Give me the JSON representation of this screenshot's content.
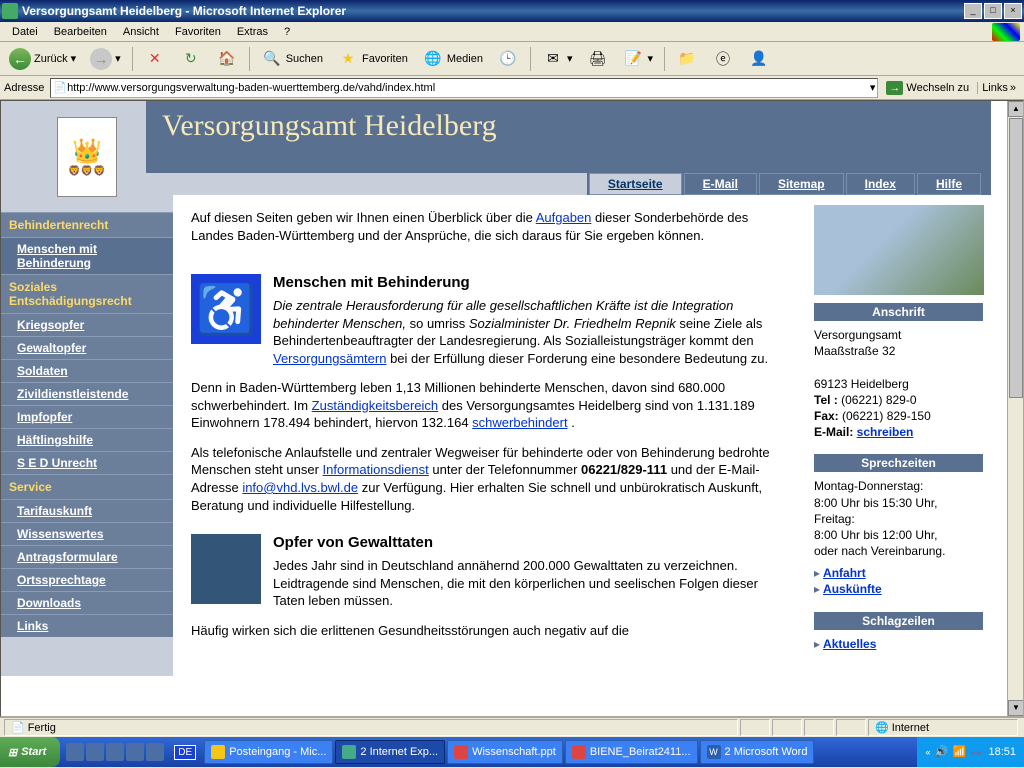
{
  "window": {
    "title": "Versorgungsamt Heidelberg - Microsoft Internet Explorer"
  },
  "menu": {
    "items": [
      "Datei",
      "Bearbeiten",
      "Ansicht",
      "Favoriten",
      "Extras",
      "?"
    ]
  },
  "toolbar": {
    "back": "Zurück",
    "search": "Suchen",
    "favorites": "Favoriten",
    "media": "Medien"
  },
  "address": {
    "label": "Adresse",
    "url": "http://www.versorgungsverwaltung-baden-wuerttemberg.de/vahd/index.html",
    "go": "Wechseln zu",
    "links": "Links"
  },
  "page": {
    "site_title": "Versorgungsamt Heidelberg",
    "topnav": [
      "Startseite",
      "E-Mail",
      "Sitemap",
      "Index",
      "Hilfe"
    ],
    "sidenav": {
      "cat1": "Behindertenrecht",
      "cat1_items": [
        "Menschen mit Behinderung"
      ],
      "cat2": "Soziales Entschädigungsrecht",
      "cat2_items": [
        "Kriegsopfer",
        "Gewaltopfer",
        "Soldaten",
        "Zivildienstleistende",
        "Impfopfer",
        "Häftlingshilfe",
        "S E D Unrecht"
      ],
      "cat3": "Service",
      "cat3_items": [
        "Tarifauskunft",
        "Wissenswertes",
        "Antragsformulare",
        "Ortssprechtage",
        "Downloads",
        "Links"
      ]
    },
    "intro": {
      "part1": "Auf diesen Seiten geben wir Ihnen einen   Überblick   über die ",
      "link1": "Aufgaben",
      "part2": "  dieser Sonderbehörde des Landes Baden-Württemberg und der Ansprüche, die sich daraus für Sie ergeben können."
    },
    "section1": {
      "head": "Menschen mit Behinderung",
      "p1a": "Die zentrale Herausforderung für alle gesellschaftlichen Kräfte ist die Integration behinderter Menschen,",
      "p1b": " so umriss ",
      "p1c": "Sozialminister Dr. Friedhelm Repnik",
      "p1d": " seine Ziele als Behindertenbeauftragter der Landesregierung. Als Sozialleistungsträger kommt den  ",
      "link1": "Versorgungsämtern",
      "p1e": " bei der Erfüllung dieser Forderung eine besondere Bedeutung zu.",
      "p2a": "Denn in Baden-Württemberg leben 1,13 Millionen behinderte Menschen, davon sind 680.000 schwerbehindert. Im ",
      "link2": "Zuständigkeitsbereich",
      "p2b": " des Versorgungsamtes Heidelberg sind von 1.131.189 Einwohnern 178.494 behindert, hiervon 132.164 ",
      "link3": "schwerbehindert",
      "p2c": ".",
      "p3a": "Als telefonische Anlaufstelle und zentraler Wegweiser für behinderte oder von Behinderung bedrohte Menschen steht unser ",
      "link4": "Informationsdienst",
      "p3b": " unter der Telefonnummer ",
      "p3c": "06221/829-111",
      "p3d": " und der E-Mail-Adresse ",
      "link5": "info@vhd.lvs.bwl.de",
      "p3e": " zur Verfügung. Hier erhalten Sie schnell und unbürokratisch Auskunft, Beratung und individuelle Hilfestellung."
    },
    "section2": {
      "head": "Opfer von Gewalttaten",
      "p1": "Jedes Jahr sind in Deutschland annähernd 200.000 Gewalttaten zu verzeichnen. Leidtragende sind Menschen, die mit den körperlichen und seelischen Folgen dieser Taten leben müssen.",
      "p2": "Häufig wirken sich die erlittenen Gesundheitsstörungen auch negativ auf die"
    },
    "right": {
      "anschrift_head": "Anschrift",
      "anschrift_l1": "Versorgungsamt",
      "anschrift_l2": "Maaßstraße 32",
      "anschrift_l3": "69123 Heidelberg",
      "tel_label": "Tel : ",
      "tel": "(06221) 829-0",
      "fax_label": "Fax: ",
      "fax": "(06221) 829-150",
      "email_label": "E-Mail: ",
      "email_link": "schreiben",
      "sprech_head": "Sprechzeiten",
      "sprech_l1": "Montag-Donnerstag:",
      "sprech_l2": "8:00 Uhr bis 15:30 Uhr,",
      "sprech_l3": "Freitag:",
      "sprech_l4": "8:00 Uhr bis 12:00 Uhr,",
      "sprech_l5": "oder nach Vereinbarung.",
      "anfahrt": "Anfahrt",
      "auskuenfte": "Auskünfte",
      "schlag_head": "Schlagzeilen",
      "aktuelles": "Aktuelles"
    }
  },
  "status": {
    "ready": "Fertig",
    "zone": "Internet"
  },
  "taskbar": {
    "start": "Start",
    "lang": "DE",
    "tasks": [
      "Posteingang - Mic...",
      "2 Internet Exp...",
      "Wissenschaft.ppt",
      "BIENE_Beirat2411...",
      "2 Microsoft Word"
    ],
    "clock": "18:51"
  }
}
